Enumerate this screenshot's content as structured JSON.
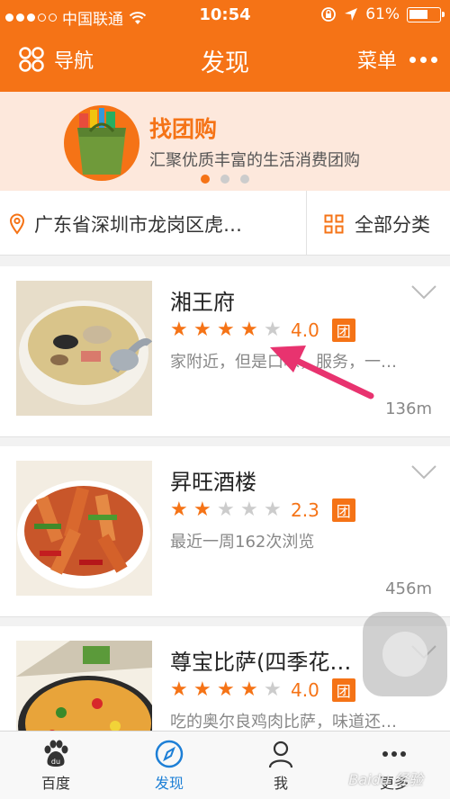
{
  "status_bar": {
    "carrier": "中国联通",
    "time": "10:54",
    "battery": "61%",
    "battery_level": 0.61
  },
  "nav": {
    "left_label": "导航",
    "title": "发现",
    "right_label": "菜单"
  },
  "banner": {
    "title": "找团购",
    "subtitle": "汇聚优质丰富的生活消费团购",
    "page_count": 3,
    "active_page": 0
  },
  "location": {
    "address": "广东省深圳市龙岗区虎…",
    "category": "全部分类"
  },
  "list": [
    {
      "name": "湘王府",
      "rating": 4.0,
      "rating_text": "4.0",
      "badge": "团",
      "desc": "家附近，但是口味，服务，一…",
      "distance": "136m"
    },
    {
      "name": "昇旺酒楼",
      "rating": 2.3,
      "rating_text": "2.3",
      "badge": "团",
      "desc": "最近一周162次浏览",
      "distance": "456m"
    },
    {
      "name": "尊宝比萨(四季花…",
      "rating": 4.0,
      "rating_text": "4.0",
      "badge": "团",
      "desc": "吃的奥尔良鸡肉比萨，味道还…",
      "distance": ""
    }
  ],
  "tabs": [
    {
      "label": "百度",
      "icon": "baidu-paw-icon"
    },
    {
      "label": "发现",
      "icon": "compass-icon",
      "active": true
    },
    {
      "label": "我",
      "icon": "person-icon"
    },
    {
      "label": "更多",
      "icon": "more-dots-icon"
    }
  ],
  "watermark": "Baidu 经验",
  "colors": {
    "accent": "#f57316",
    "active_tab": "#1d7fd6",
    "annotation_arrow": "#e8336f"
  }
}
